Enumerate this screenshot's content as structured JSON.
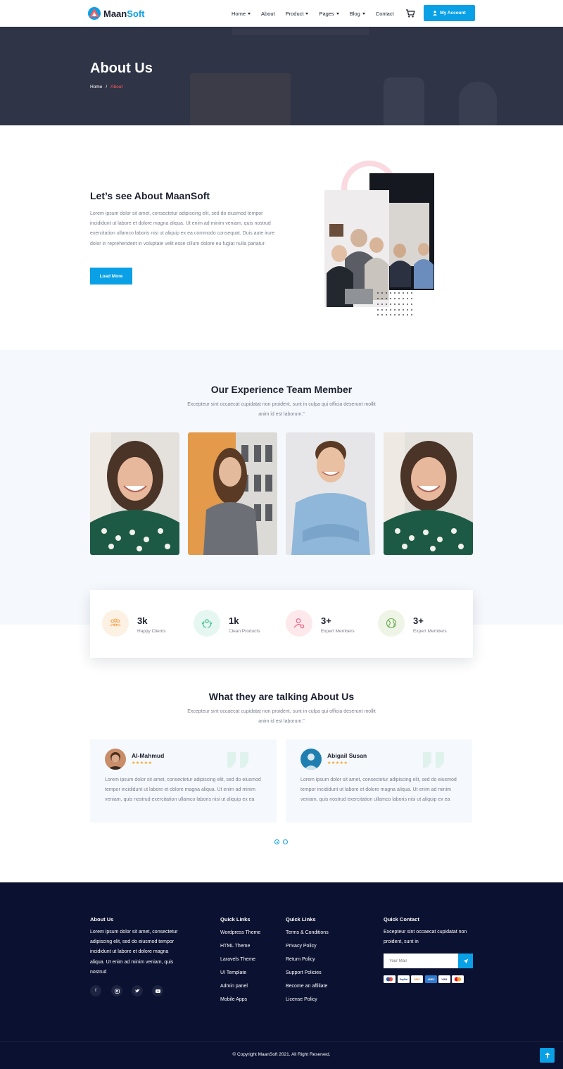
{
  "header": {
    "logo": {
      "part1": "Maan",
      "part2": "Soft"
    },
    "nav": [
      {
        "label": "Home",
        "dropdown": true
      },
      {
        "label": "About",
        "dropdown": false
      },
      {
        "label": "Product",
        "dropdown": true
      },
      {
        "label": "Pages",
        "dropdown": true
      },
      {
        "label": "Blog",
        "dropdown": true
      },
      {
        "label": "Contact",
        "dropdown": false
      }
    ],
    "cart_icon": "cart-icon",
    "account_label": "My Account",
    "account_icon": "user-icon"
  },
  "hero": {
    "title": "About Us",
    "breadcrumb": {
      "home": "Home",
      "separator": "/",
      "current": "About"
    }
  },
  "about": {
    "title": "Let’s see About MaanSoft",
    "text": "Lorem ipsum dolor sit amet, consectetur adipiscing elit, sed do eiusmod tempor incididunt ut labore et dolore magna aliqua. Ut enim ad minim veniam, quis nostrud exercitation ullamco laboris nisi ut aliquip ex ea commodo consequat. Duis aute irure dolor in reprehenderit in voluptate velit esse cillum dolore eu fugiat nulla pariatur.",
    "button": "Load More"
  },
  "team": {
    "title": "Our Experience Team Member",
    "subtitle": "Excepteur sint occaecat cupidatat non proident, sunt in culpa qui officia deserunt mollit anim id est laborum.\""
  },
  "stats": [
    {
      "value": "3k",
      "label": "Happy Clients",
      "icon": "group-icon",
      "bg": "#fdf1e4",
      "color": "#f59e42"
    },
    {
      "value": "1k",
      "label": "Clean Products",
      "icon": "hands-icon",
      "bg": "#e5f7f0",
      "color": "#35b98a"
    },
    {
      "value": "3+",
      "label": "Expert Members",
      "icon": "user-settings-icon",
      "bg": "#fde8ec",
      "color": "#ee5a78"
    },
    {
      "value": "3+",
      "label": "Expert Members",
      "icon": "globe-icon",
      "bg": "#eef5e6",
      "color": "#6aa84f"
    }
  ],
  "testimonials": {
    "title": "What they are talking About Us",
    "subtitle": "Excepteur sint occaecat cupidatat non proident, sunt in culpa qui officia deserunt mollit anim id est laborum.\"",
    "items": [
      {
        "name": "Al-Mahmud",
        "stars": "★★★★★",
        "text": "Lorem ipsum dolor sit amet, consectetur adipiscing elit, sed do eiusmod tempor incididunt ut labore et dolore magna aliqua. Ut enim ad minim veniam, quis nostrud exercitation ullamco laboris nisi ut aliquip ex ea"
      },
      {
        "name": "Abigail Susan",
        "stars": "★★★★★",
        "text": "Lorem ipsum dolor sit amet, consectetur adipiscing elit, sed do eiusmod tempor incididunt ut labore et dolore magna aliqua. Ut enim ad minim veniam, quis nostrud exercitation ullamco laboris nisi ut aliquip ex ea"
      }
    ],
    "active_page": 1,
    "pages": 2
  },
  "footer": {
    "about_title": "About Us",
    "about_text": "Lorem ipsum dolor sit amet, consectetur adipiscing elit, sed do eiusmod tempor incididunt ut labore et dolore magna aliqua. Ut enim ad minim veniam, quis nostrud",
    "social": [
      "facebook-icon",
      "instagram-icon",
      "twitter-icon",
      "youtube-icon"
    ],
    "quick1_title": "Quick Links",
    "quick1": [
      "Wordpress Theme",
      "HTML Theme",
      "Laravels Theme",
      "UI Template",
      "Admin panel",
      "Mobile Apps"
    ],
    "quick2_title": "Quick Links",
    "quick2": [
      "Terms & Conditions",
      "Privacy Policy",
      "Return Policy",
      "Support Policies",
      "Become an affiliate",
      "License Policy"
    ],
    "contact_title": "Quick Contact",
    "contact_text": "Excepteur sint occaecat cupidatat non proident, sunt in",
    "mail_placeholder": "Your Mail",
    "payments": [
      "Maestro",
      "PayPal",
      "Discover",
      "Amex",
      "VISA",
      "MasterCard"
    ],
    "copyright": "© Copyright MaanSoft 2021. All Right Reserved."
  }
}
